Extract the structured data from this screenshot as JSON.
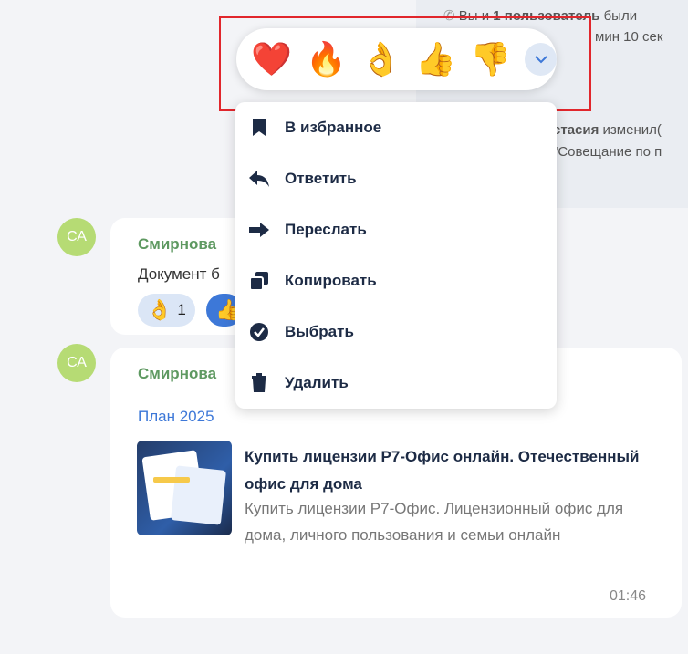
{
  "system_message": {
    "line1_prefix": "Вы и ",
    "line1_bold": "1 пользователь",
    "line1_suffix": " были",
    "line2": "мин 10 сек",
    "line3_bold": "стасия",
    "line3_suffix": " изменил(",
    "line4": "\"Совещание по п"
  },
  "messages": [
    {
      "avatar": "СА",
      "sender": "Смирнова",
      "text": "Документ б",
      "reactions": [
        {
          "emoji": "👌",
          "count": "1"
        },
        {
          "emoji": "👍",
          "count": ""
        }
      ]
    },
    {
      "avatar": "СА",
      "sender": "Смирнова",
      "link_title": "План 2025",
      "preview": {
        "title": "Купить лицензии Р7-Офис онлайн. Отечественный офис для дома",
        "description": "Купить лицензии Р7-Офис. Лицензионный офис для дома, личного пользования и семьи онлайн"
      },
      "time": "01:46"
    }
  ],
  "reaction_bar": {
    "emojis": [
      "❤️",
      "🔥",
      "👌",
      "👍",
      "👎"
    ],
    "expand_icon": "chevron-down-icon"
  },
  "context_menu": {
    "items": [
      {
        "label": "В избранное",
        "icon": "bookmark-icon"
      },
      {
        "label": "Ответить",
        "icon": "reply-icon"
      },
      {
        "label": "Переслать",
        "icon": "forward-icon"
      },
      {
        "label": "Копировать",
        "icon": "copy-icon"
      },
      {
        "label": "Выбрать",
        "icon": "check-circle-icon"
      },
      {
        "label": "Удалить",
        "icon": "trash-icon"
      }
    ]
  },
  "colors": {
    "accent": "#3d78d8",
    "sender": "#5e9961",
    "avatar": "#b6db74",
    "highlight": "#e1262c",
    "menu_text": "#1d2b45"
  }
}
